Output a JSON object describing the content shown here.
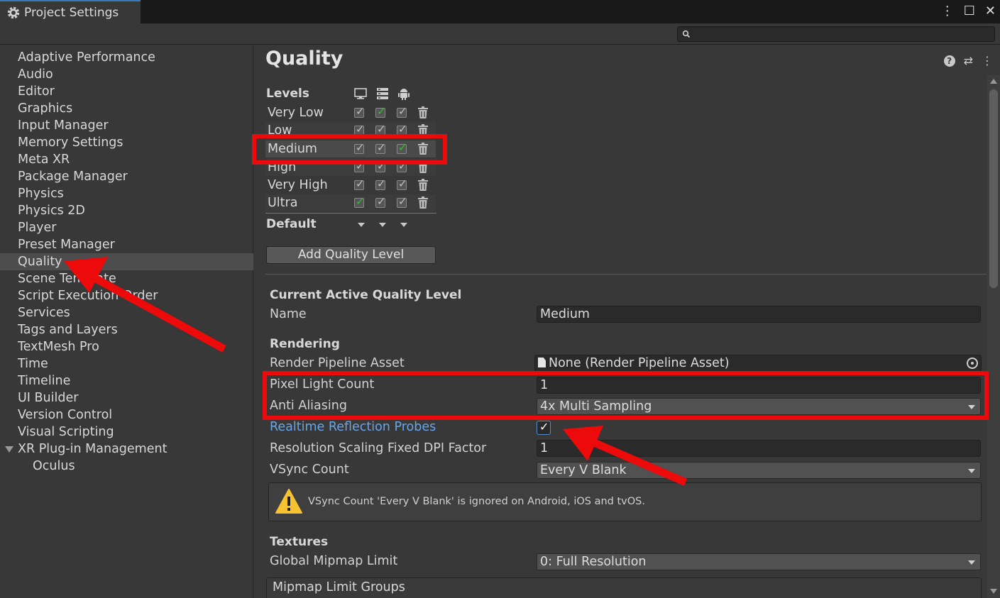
{
  "window": {
    "title": "Project Settings"
  },
  "search": {
    "placeholder": "",
    "value": ""
  },
  "sidebar": {
    "items": [
      {
        "label": "Adaptive Performance"
      },
      {
        "label": "Audio"
      },
      {
        "label": "Editor"
      },
      {
        "label": "Graphics"
      },
      {
        "label": "Input Manager"
      },
      {
        "label": "Memory Settings"
      },
      {
        "label": "Meta XR"
      },
      {
        "label": "Package Manager"
      },
      {
        "label": "Physics"
      },
      {
        "label": "Physics 2D"
      },
      {
        "label": "Player"
      },
      {
        "label": "Preset Manager"
      },
      {
        "label": "Quality",
        "selected": true
      },
      {
        "label": "Scene Template"
      },
      {
        "label": "Script Execution Order"
      },
      {
        "label": "Services"
      },
      {
        "label": "Tags and Layers"
      },
      {
        "label": "TextMesh Pro"
      },
      {
        "label": "Time"
      },
      {
        "label": "Timeline"
      },
      {
        "label": "UI Builder"
      },
      {
        "label": "Version Control"
      },
      {
        "label": "Visual Scripting"
      },
      {
        "label": "XR Plug-in Management",
        "expanded": true
      },
      {
        "label": "Oculus",
        "child": true
      }
    ]
  },
  "main": {
    "title": "Quality",
    "levels": {
      "header": "Levels",
      "platform_icons": [
        "monitor-icon",
        "server-icon",
        "android-icon"
      ],
      "rows": [
        {
          "name": "Very Low",
          "checks": [
            true,
            true,
            true
          ],
          "default_platform": 1
        },
        {
          "name": "Low",
          "checks": [
            true,
            true,
            true
          ],
          "default_platform": -1
        },
        {
          "name": "Medium",
          "checks": [
            true,
            true,
            true
          ],
          "default_platform": 2,
          "selected": true
        },
        {
          "name": "High",
          "checks": [
            true,
            true,
            true
          ],
          "default_platform": -1
        },
        {
          "name": "Very High",
          "checks": [
            true,
            true,
            true
          ],
          "default_platform": -1
        },
        {
          "name": "Ultra",
          "checks": [
            true,
            true,
            true
          ],
          "default_platform": 0
        }
      ],
      "default_label": "Default"
    },
    "add_level_label": "Add Quality Level",
    "current": {
      "header": "Current Active Quality Level",
      "name_label": "Name",
      "name_value": "Medium"
    },
    "rendering": {
      "header": "Rendering",
      "rp_asset_label": "Render Pipeline Asset",
      "rp_asset_value": "None (Render Pipeline Asset)",
      "pixel_light_label": "Pixel Light Count",
      "pixel_light_value": "1",
      "aa_label": "Anti Aliasing",
      "aa_value": "4x Multi Sampling",
      "reflection_label": "Realtime Reflection Probes",
      "reflection_checked": true,
      "dpi_label": "Resolution Scaling Fixed DPI Factor",
      "dpi_value": "1",
      "vsync_label": "VSync Count",
      "vsync_value": "Every V Blank",
      "vsync_warning": "VSync Count 'Every V Blank' is ignored on Android, iOS and tvOS."
    },
    "textures": {
      "header": "Textures",
      "mipmap_label": "Global Mipmap Limit",
      "mipmap_value": "0: Full Resolution",
      "groups_label": "Mipmap Limit Groups"
    }
  },
  "colors": {
    "annotation": "#ec0a0a",
    "selection_accent": "#3a79bb",
    "check_green": "#2fbf2f",
    "link_blue": "#6aa5e9"
  }
}
